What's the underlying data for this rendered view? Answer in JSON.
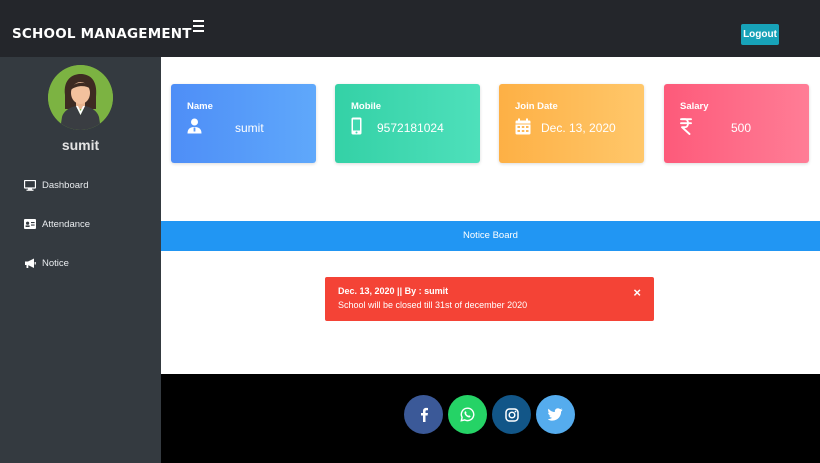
{
  "header": {
    "brand": "SCHOOL MANAGEMENT",
    "logout_label": "Logout"
  },
  "sidebar": {
    "username": "sumit",
    "items": [
      {
        "label": "Dashboard",
        "icon": "monitor-icon"
      },
      {
        "label": "Attendance",
        "icon": "id-card-icon"
      },
      {
        "label": "Notice",
        "icon": "megaphone-icon"
      }
    ]
  },
  "cards": [
    {
      "label": "Name",
      "value": "sumit",
      "icon": "user-icon",
      "color_from": "#4e8ef7",
      "color_to": "#5fa8fb"
    },
    {
      "label": "Mobile",
      "value": "9572181024",
      "icon": "mobile-icon",
      "color_from": "#34d1a6",
      "color_to": "#4ee0bb"
    },
    {
      "label": "Join Date",
      "value": "Dec. 13, 2020",
      "icon": "calendar-icon",
      "color_from": "#fdb045",
      "color_to": "#ffc76a"
    },
    {
      "label": "Salary",
      "value": "500",
      "icon": "rupee-icon",
      "color_from": "#fd5a7a",
      "color_to": "#ff7d96"
    }
  ],
  "notice_board": {
    "title": "Notice Board"
  },
  "notice": {
    "heading": "Dec. 13, 2020 || By : sumit",
    "body": "School will be closed till 31st of december 2020",
    "close": "×"
  },
  "footer": {
    "social": [
      {
        "icon": "facebook-icon",
        "color": "#3b5998"
      },
      {
        "icon": "whatsapp-icon",
        "color": "#25d366"
      },
      {
        "icon": "instagram-icon",
        "color": "#125688"
      },
      {
        "icon": "twitter-icon",
        "color": "#55acee"
      }
    ]
  },
  "colors": {
    "topbar": "#24262b",
    "sidebar": "#343a40",
    "logout": "#17a2b8",
    "notice_bar": "#2196f3",
    "alert": "#f44336",
    "footer": "#000000"
  }
}
